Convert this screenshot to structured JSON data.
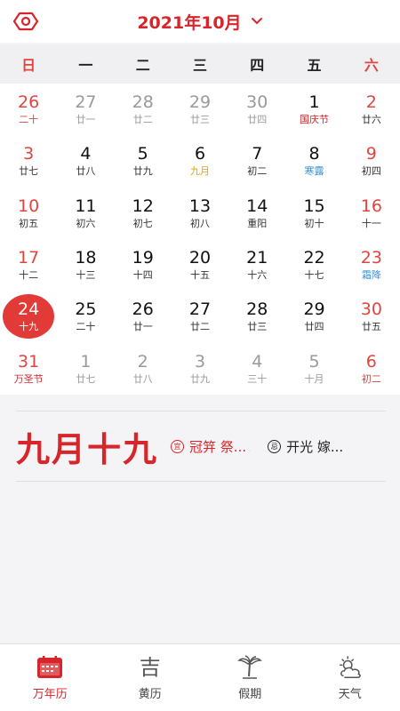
{
  "header": {
    "title": "2021年10月"
  },
  "colors": {
    "accent": "#d7262b",
    "weekend": "#e0453f",
    "solar_term": "#3b8fd1",
    "lunar_month": "#e0a800"
  },
  "weekdays": [
    "日",
    "一",
    "二",
    "三",
    "四",
    "五",
    "六"
  ],
  "calendar": {
    "weeks": [
      [
        {
          "day": "26",
          "lunar": "二十",
          "state": "outside"
        },
        {
          "day": "27",
          "lunar": "廿一",
          "state": "outside"
        },
        {
          "day": "28",
          "lunar": "廿二",
          "state": "outside"
        },
        {
          "day": "29",
          "lunar": "廿三",
          "state": "outside"
        },
        {
          "day": "30",
          "lunar": "廿四",
          "state": "outside"
        },
        {
          "day": "1",
          "lunar": "国庆节",
          "lunar_style": "holiday"
        },
        {
          "day": "2",
          "lunar": "廿六"
        }
      ],
      [
        {
          "day": "3",
          "lunar": "廿七"
        },
        {
          "day": "4",
          "lunar": "廿八"
        },
        {
          "day": "5",
          "lunar": "廿九"
        },
        {
          "day": "6",
          "lunar": "九月",
          "lunar_style": "month"
        },
        {
          "day": "7",
          "lunar": "初二"
        },
        {
          "day": "8",
          "lunar": "寒露",
          "lunar_style": "term"
        },
        {
          "day": "9",
          "lunar": "初四"
        }
      ],
      [
        {
          "day": "10",
          "lunar": "初五"
        },
        {
          "day": "11",
          "lunar": "初六"
        },
        {
          "day": "12",
          "lunar": "初七"
        },
        {
          "day": "13",
          "lunar": "初八"
        },
        {
          "day": "14",
          "lunar": "重阳"
        },
        {
          "day": "15",
          "lunar": "初十"
        },
        {
          "day": "16",
          "lunar": "十一"
        }
      ],
      [
        {
          "day": "17",
          "lunar": "十二"
        },
        {
          "day": "18",
          "lunar": "十三"
        },
        {
          "day": "19",
          "lunar": "十四"
        },
        {
          "day": "20",
          "lunar": "十五"
        },
        {
          "day": "21",
          "lunar": "十六"
        },
        {
          "day": "22",
          "lunar": "十七"
        },
        {
          "day": "23",
          "lunar": "霜降",
          "lunar_style": "term"
        }
      ],
      [
        {
          "day": "24",
          "lunar": "十九",
          "state": "today"
        },
        {
          "day": "25",
          "lunar": "二十"
        },
        {
          "day": "26",
          "lunar": "廿一"
        },
        {
          "day": "27",
          "lunar": "廿二"
        },
        {
          "day": "28",
          "lunar": "廿三"
        },
        {
          "day": "29",
          "lunar": "廿四"
        },
        {
          "day": "30",
          "lunar": "廿五"
        }
      ],
      [
        {
          "day": "31",
          "lunar": "万圣节",
          "lunar_style": "holiday"
        },
        {
          "day": "1",
          "lunar": "廿七",
          "state": "outside"
        },
        {
          "day": "2",
          "lunar": "廿八",
          "state": "outside"
        },
        {
          "day": "3",
          "lunar": "廿九",
          "state": "outside"
        },
        {
          "day": "4",
          "lunar": "三十",
          "state": "outside"
        },
        {
          "day": "5",
          "lunar": "十月",
          "state": "outside"
        },
        {
          "day": "6",
          "lunar": "初二",
          "state": "outside"
        }
      ]
    ]
  },
  "info": {
    "lunar_date": "九月十九",
    "good_badge": "宜",
    "good_text": "冠笄 祭...",
    "bad_badge": "忌",
    "bad_text": "开光 嫁..."
  },
  "tabs": [
    {
      "label": "万年历",
      "icon": "calendar-icon",
      "active": true
    },
    {
      "label": "黄历",
      "icon": "ji-icon",
      "glyph": "吉"
    },
    {
      "label": "假期",
      "icon": "palm-tree-icon"
    },
    {
      "label": "天气",
      "icon": "weather-icon"
    }
  ]
}
